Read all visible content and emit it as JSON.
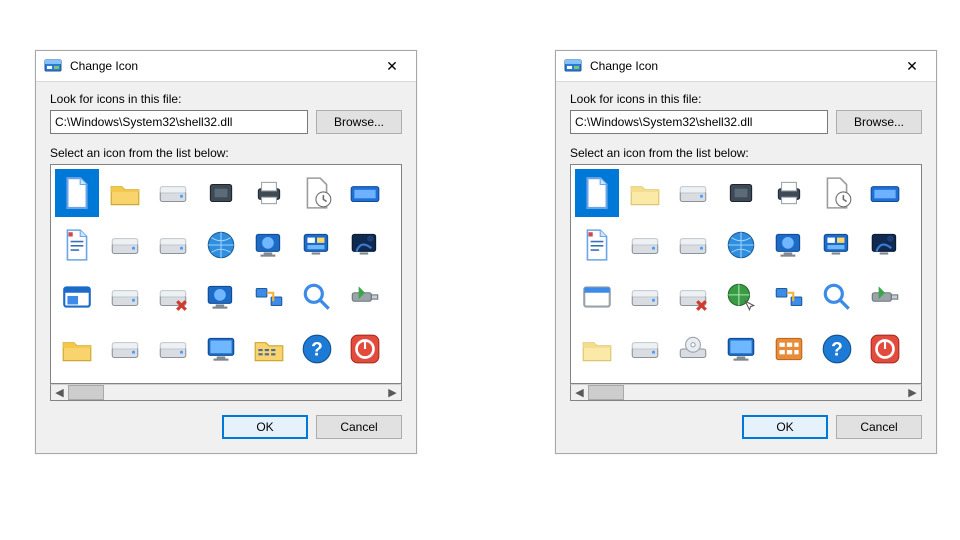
{
  "dialogs": [
    {
      "id": "left",
      "title": "Change Icon",
      "look_label": "Look for icons in this file:",
      "path_value": "C:\\Windows\\System32\\shell32.dll",
      "browse_label": "Browse...",
      "select_label": "Select an icon from the list below:",
      "ok_label": "OK",
      "cancel_label": "Cancel",
      "selected_index": 0,
      "icons": [
        "document",
        "folder",
        "hdd",
        "ssd",
        "printer",
        "history-doc",
        "run",
        "text-doc",
        "zip-drive",
        "removable",
        "globe",
        "monitor-globe",
        "control-screen",
        "screensaver",
        "window",
        "floppy",
        "floppy-x",
        "monitor-globe",
        "network-places",
        "search",
        "usb-arrow",
        "folder",
        "hdd",
        "hdd-dark",
        "display",
        "details-folder",
        "help",
        "power"
      ]
    },
    {
      "id": "right",
      "title": "Change Icon",
      "look_label": "Look for icons in this file:",
      "path_value": "C:\\Windows\\System32\\shell32.dll",
      "browse_label": "Browse...",
      "select_label": "Select an icon from the list below:",
      "ok_label": "OK",
      "cancel_label": "Cancel",
      "selected_index": 0,
      "icons": [
        "document",
        "folder-pale",
        "hdd3d",
        "chip",
        "printer3d",
        "history-doc",
        "run",
        "text-doc",
        "drive-stack",
        "drive-stack2",
        "globe3d",
        "monitor-globe",
        "control-screen",
        "screensaver",
        "window-lite",
        "floppy3d",
        "floppy3d-x",
        "globe-mouse",
        "network-places",
        "search",
        "usb-arrow",
        "folder-pale",
        "drive3d",
        "cd-drive",
        "display3d",
        "details-orange",
        "help",
        "power"
      ]
    }
  ]
}
